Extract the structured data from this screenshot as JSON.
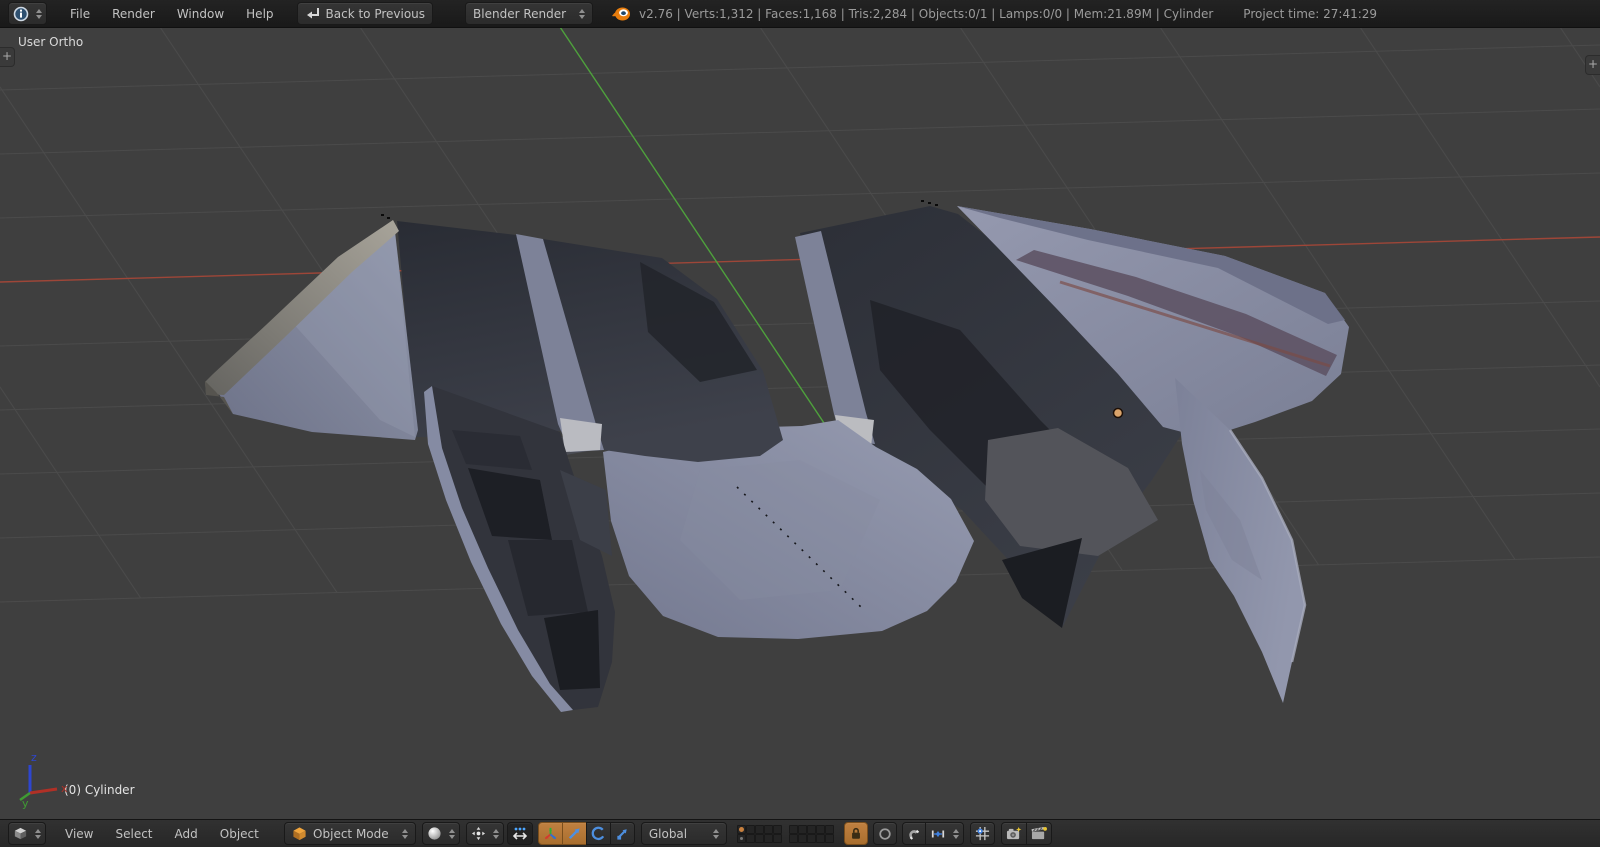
{
  "app": {
    "name": "Blender"
  },
  "top_header": {
    "menus": [
      "File",
      "Render",
      "Window",
      "Help"
    ],
    "back_button": "Back to Previous",
    "engine": "Blender Render",
    "stats": "v2.76 | Verts:1,312 | Faces:1,168 | Tris:2,284 | Objects:0/1 | Lamps:0/0 | Mem:21.89M | Cylinder",
    "project_time": "Project time: 27:41:29"
  },
  "viewport": {
    "view_label": "User Ortho",
    "object_label": "(0) Cylinder",
    "add_region_tab": "+",
    "axis": {
      "x": "x",
      "y": "y",
      "z": "z"
    }
  },
  "bottom_header": {
    "menus": [
      "View",
      "Select",
      "Add",
      "Object"
    ],
    "mode": "Object Mode",
    "orientation": "Global",
    "layers": {
      "active_index": 0,
      "dot_index": 5
    }
  },
  "icons": {
    "info-icon": "circled i",
    "back-icon": "return arrow",
    "blender-logo": "orange swirl",
    "cube-icon": "orange cube",
    "shading-sphere-icon": "white sphere",
    "pivot-icon": "median point",
    "manipulate-centers-icon": "dots + double arrow",
    "manipulator-icon": "rgb tripod",
    "translate-icon": "blue arrow",
    "rotate-icon": "blue arc",
    "scale-icon": "blue square arrow",
    "lock-to-scene-icon": "padlock",
    "proportional-edit-icon": "circle",
    "snap-magnet-icon": "magnet",
    "snap-increment-icon": "blue increment",
    "absolute-grid-snap-icon": "grid with dot",
    "opengl-render-icon": "camera +",
    "opengl-anim-icon": "clapperboard +",
    "plus-icon": "+"
  },
  "colors": {
    "viewport_bg": "#3f3f3f",
    "grid_line": "#4b4b4b",
    "axis_x_red": "#9e4638",
    "axis_y_green": "#4ea13c",
    "accent_orange": "#b5793b",
    "origin_dot": "#dba46b",
    "mesh_lavender": "#8e93a9",
    "mesh_dark": "#2b2e36"
  }
}
